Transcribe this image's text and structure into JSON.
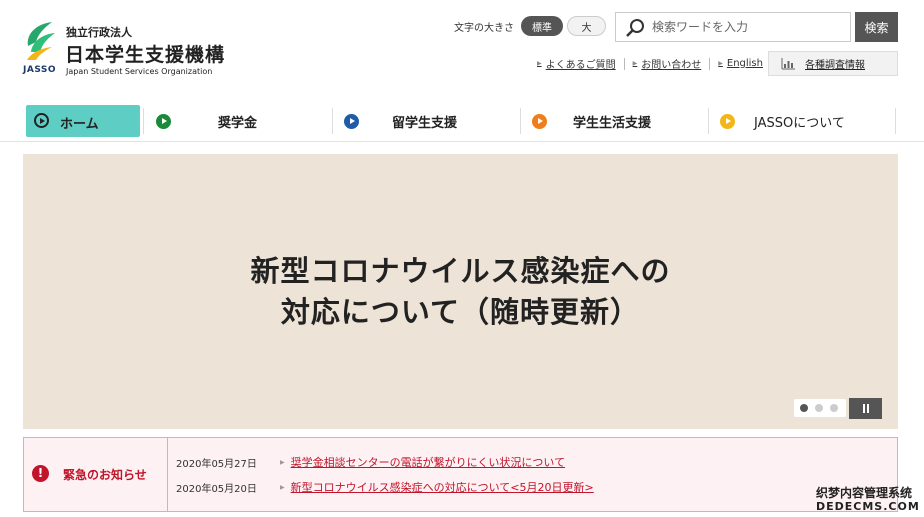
{
  "header": {
    "org_small": "独立行政法人",
    "org_name": "日本学生支援機構",
    "org_abbr": "JASSO",
    "org_english": "Japan Student Services Organization"
  },
  "font_size": {
    "label": "文字の大きさ",
    "standard": "標準",
    "large": "大",
    "selected": "標準"
  },
  "search": {
    "placeholder": "検索ワードを入力",
    "button": "検索"
  },
  "util_links": [
    "よくあるご質問",
    "お問い合わせ",
    "English"
  ],
  "survey_link": "各種調査情報",
  "nav": {
    "items": [
      {
        "label": "ホーム",
        "icon": "play-circle-icon",
        "color": "#5ecdc4",
        "active": true
      },
      {
        "label": "奨学金",
        "icon": "play-circle-icon",
        "color": "#1a8a3a"
      },
      {
        "label": "留学生支援",
        "icon": "play-circle-icon",
        "color": "#1e5ba8"
      },
      {
        "label": "学生生活支援",
        "icon": "play-circle-icon",
        "color": "#f07d1a"
      },
      {
        "label": "JASSOについて",
        "icon": "play-circle-icon",
        "color": "#f2b619"
      }
    ]
  },
  "hero": {
    "line1": "新型コロナウイルス感染症への",
    "line2": "対応について（随時更新）",
    "background": "#ede3d6",
    "slide_count": 3,
    "active_slide": 1
  },
  "alert": {
    "title": "緊急のお知らせ",
    "items": [
      {
        "date": "2020年05月27日",
        "text": "奨学金相談センターの電話が繋がりにくい状況について"
      },
      {
        "date": "2020年05月20日",
        "text": "新型コロナウイルス感染症への対応について<5月20日更新>"
      }
    ]
  },
  "watermark": {
    "line1": "织梦内容管理系统",
    "line2": "DEDECMS.COM"
  },
  "colors": {
    "brand_green": "#27a86b",
    "alert_red": "#c0152b",
    "button_dark": "#555555"
  }
}
